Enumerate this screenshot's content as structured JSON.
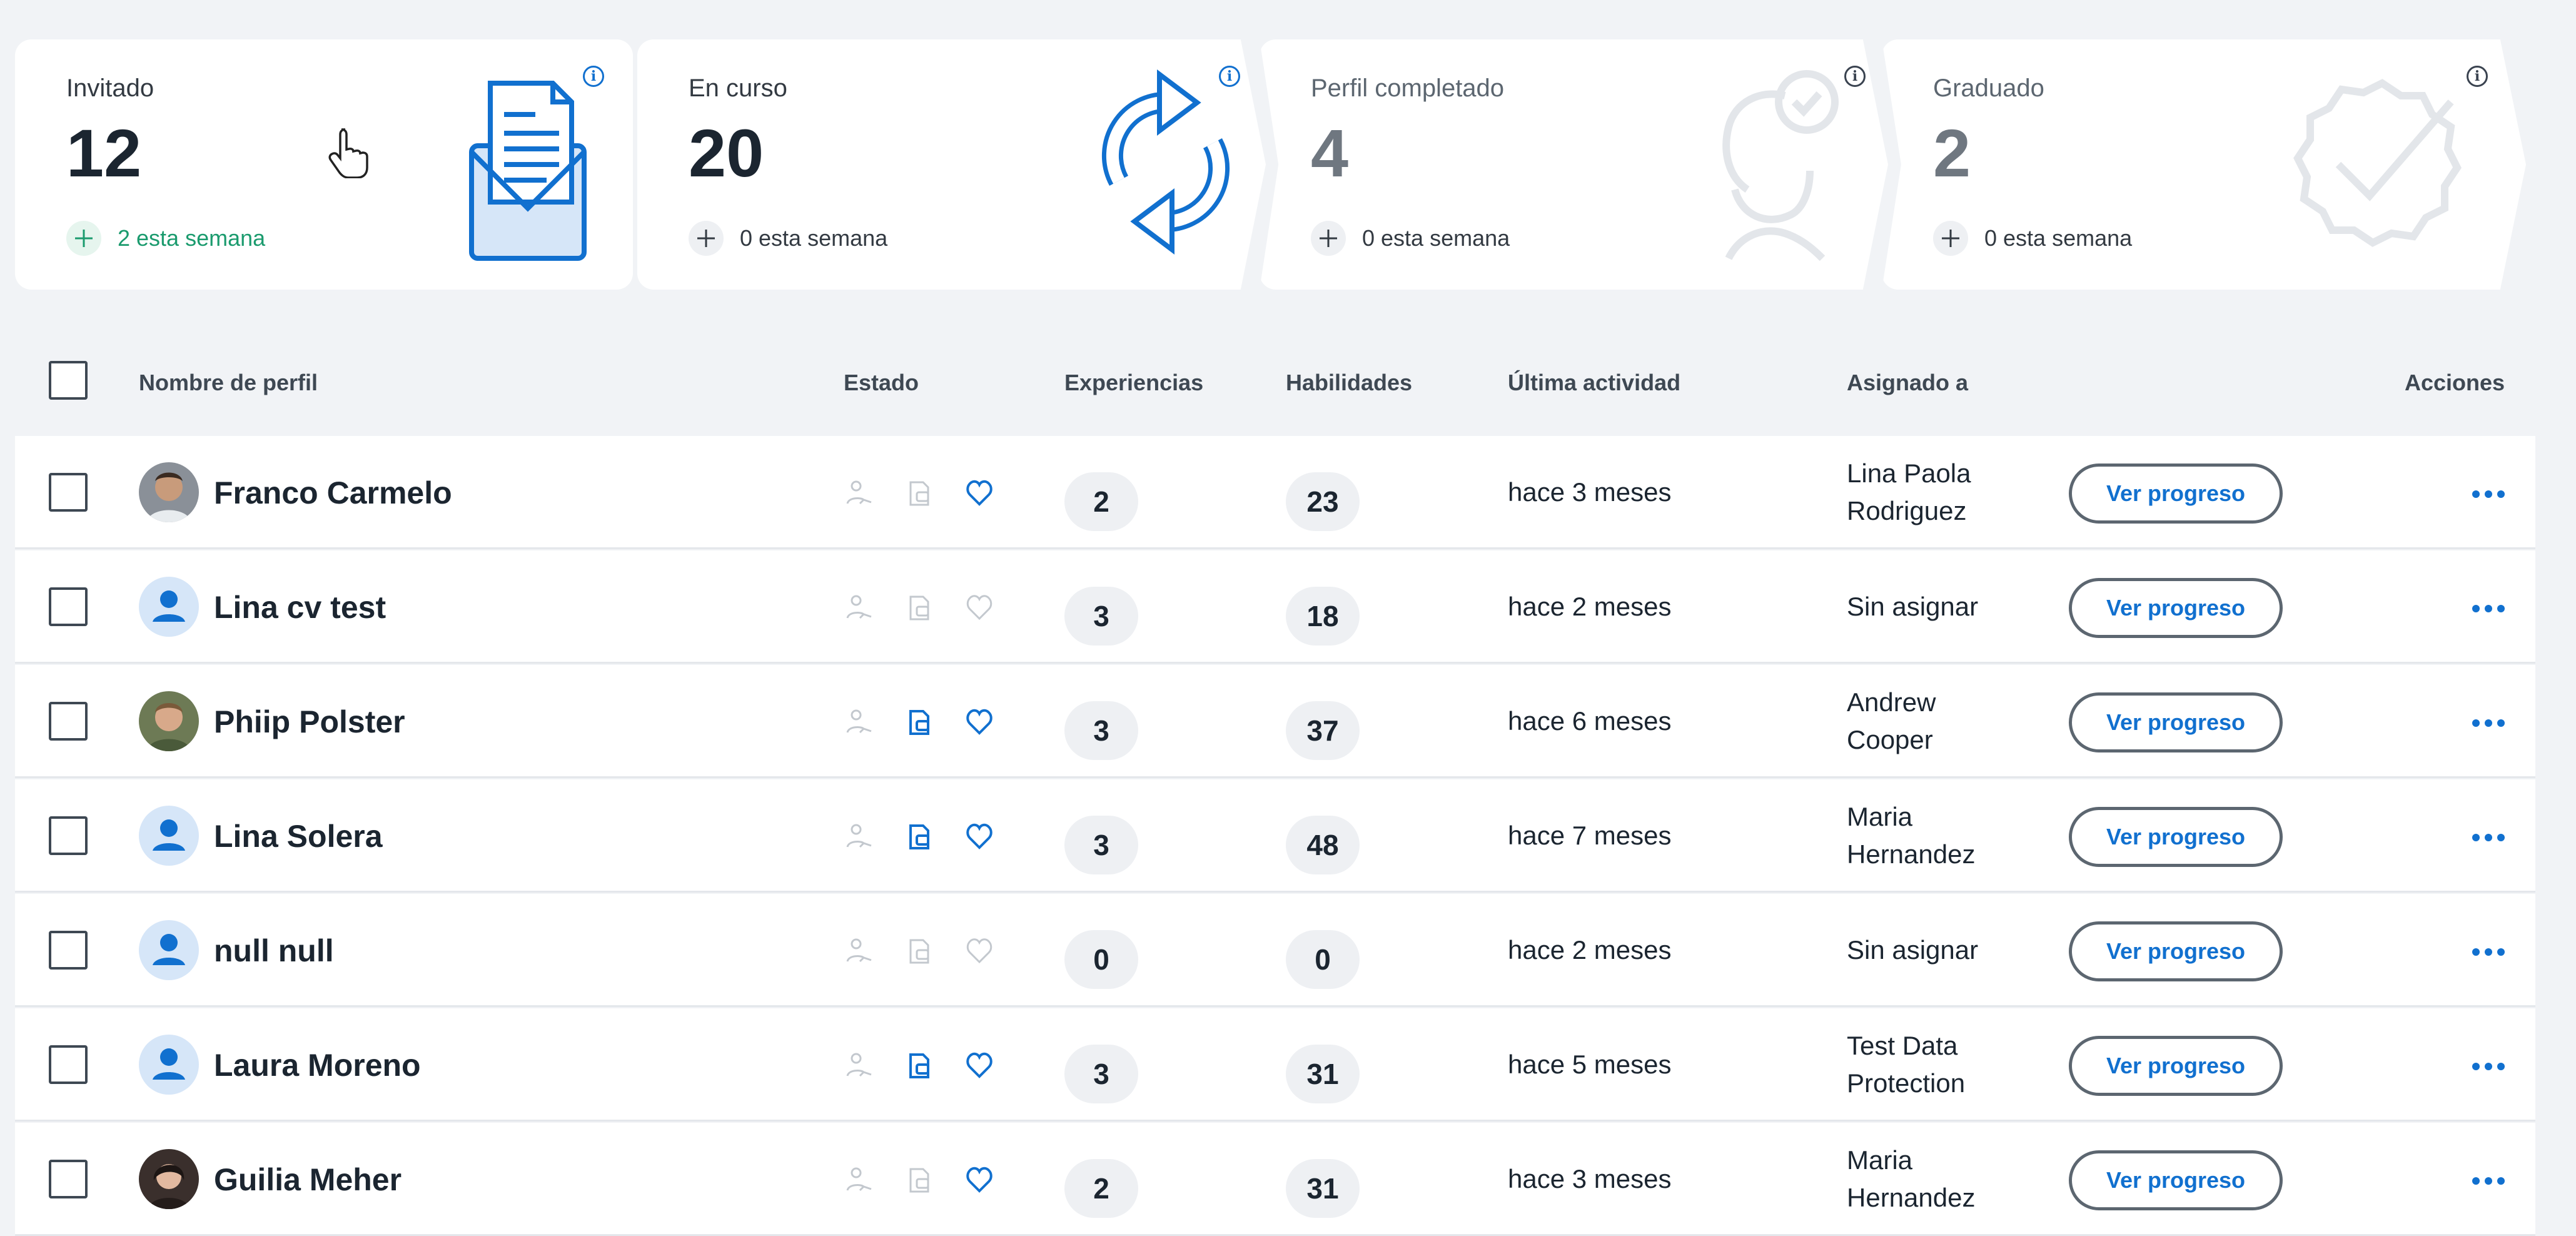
{
  "cards": [
    {
      "label": "Invitado",
      "value": "12",
      "week": "2 esta semana",
      "icon": "envelope-icon"
    },
    {
      "label": "En curso",
      "value": "20",
      "week": "0 esta semana",
      "icon": "refresh-icon"
    },
    {
      "label": "Perfil completado",
      "value": "4",
      "week": "0 esta semana",
      "icon": "user-check-icon"
    },
    {
      "label": "Graduado",
      "value": "2",
      "week": "0 esta semana",
      "icon": "badge-check-icon"
    }
  ],
  "table": {
    "columns": {
      "name": "Nombre de perfil",
      "status": "Estado",
      "experiences": "Experiencias",
      "skills": "Habilidades",
      "activity": "Última actividad",
      "assigned": "Asignado a",
      "actions": "Acciones"
    },
    "button_label": "Ver progreso",
    "rows": [
      {
        "name": "Franco Carmelo",
        "avatar": "photo",
        "status": [
          false,
          false,
          true
        ],
        "experiences": "2",
        "skills": "23",
        "activity": "hace 3 meses",
        "assigned_1": "Lina Paola",
        "assigned_2": "Rodriguez"
      },
      {
        "name": "Lina cv test",
        "avatar": "default",
        "status": [
          false,
          false,
          false
        ],
        "experiences": "3",
        "skills": "18",
        "activity": "hace 2 meses",
        "assigned_1": "Sin asignar",
        "assigned_2": ""
      },
      {
        "name": "Phiip Polster",
        "avatar": "photo",
        "status": [
          false,
          true,
          true
        ],
        "experiences": "3",
        "skills": "37",
        "activity": "hace 6 meses",
        "assigned_1": "Andrew",
        "assigned_2": "Cooper"
      },
      {
        "name": "Lina Solera",
        "avatar": "default",
        "status": [
          false,
          true,
          true
        ],
        "experiences": "3",
        "skills": "48",
        "activity": "hace 7 meses",
        "assigned_1": "Maria",
        "assigned_2": "Hernandez"
      },
      {
        "name": "null null",
        "avatar": "default",
        "status": [
          false,
          false,
          false
        ],
        "experiences": "0",
        "skills": "0",
        "activity": "hace 2 meses",
        "assigned_1": "Sin asignar",
        "assigned_2": ""
      },
      {
        "name": "Laura Moreno",
        "avatar": "default",
        "status": [
          false,
          true,
          true
        ],
        "experiences": "3",
        "skills": "31",
        "activity": "hace 5 meses",
        "assigned_1": "Test Data",
        "assigned_2": "Protection"
      },
      {
        "name": "Guilia Meher",
        "avatar": "photo",
        "status": [
          false,
          false,
          true
        ],
        "experiences": "2",
        "skills": "31",
        "activity": "hace 3 meses",
        "assigned_1": "Maria",
        "assigned_2": "Hernandez"
      }
    ]
  },
  "colors": {
    "accent": "#1170cf",
    "success": "#1b9b6e",
    "icon_muted": "#c3c8ce"
  }
}
